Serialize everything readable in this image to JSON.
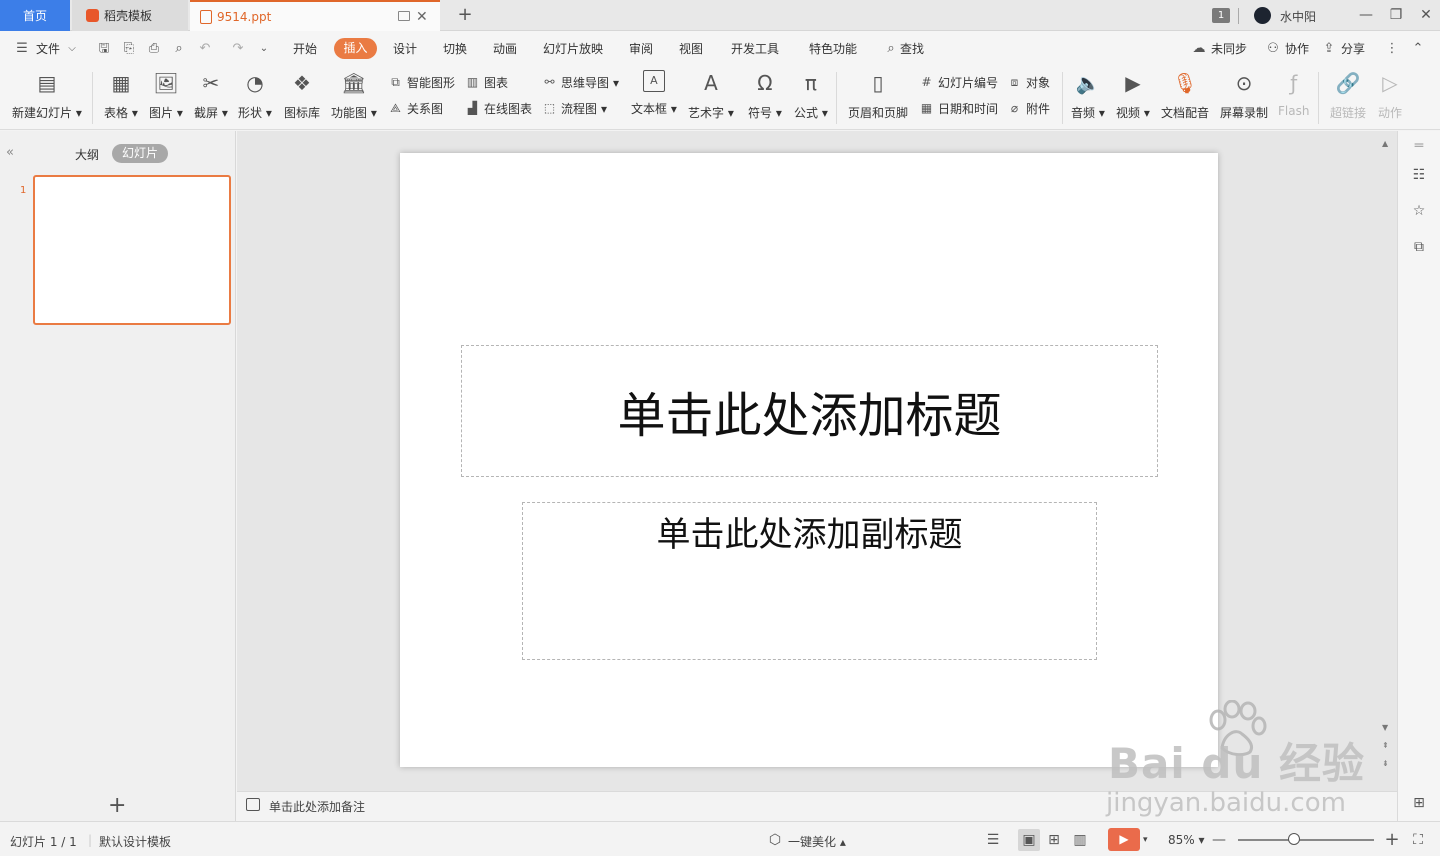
{
  "titlebar": {
    "tab_home": "首页",
    "tab_template": "稻壳模板",
    "tab_file": "9514.ppt",
    "badge": "1",
    "username": "水中阳"
  },
  "menubar": {
    "file": "文件",
    "items": [
      "开始",
      "插入",
      "设计",
      "切换",
      "动画",
      "幻灯片放映",
      "审阅",
      "视图",
      "开发工具",
      "特色功能"
    ],
    "active": "插入",
    "search": "查找",
    "unsynced": "未同步",
    "collab": "协作",
    "share": "分享"
  },
  "ribbon": {
    "new_slide": "新建幻灯片",
    "table": "表格",
    "picture": "图片",
    "screenshot": "截屏",
    "shape": "形状",
    "icon_lib": "图标库",
    "func_chart": "功能图",
    "smart_shape": "智能图形",
    "chart": "图表",
    "relation": "关系图",
    "online_chart": "在线图表",
    "mindmap": "思维导图",
    "flowchart": "流程图",
    "textbox": "文本框",
    "wordart": "艺术字",
    "symbol": "符号",
    "formula": "公式",
    "header_footer": "页眉和页脚",
    "slide_number": "幻灯片编号",
    "object": "对象",
    "date_time": "日期和时间",
    "attachment": "附件",
    "audio": "音频",
    "video": "视频",
    "doc_dub": "文档配音",
    "screen_rec": "屏幕录制",
    "flash": "Flash",
    "hyperlink": "超链接",
    "action": "动作"
  },
  "leftpanel": {
    "outline": "大纲",
    "slides": "幻灯片",
    "slide_number": "1"
  },
  "slide": {
    "title_placeholder": "单击此处添加标题",
    "subtitle_placeholder": "单击此处添加副标题"
  },
  "notes": {
    "placeholder": "单击此处添加备注"
  },
  "statusbar": {
    "slide_counter": "幻灯片 1 / 1",
    "template": "默认设计模板",
    "beautify": "一键美化",
    "zoom": "85%"
  },
  "watermark": {
    "brand": "Bai du 经验",
    "url": "jingyan.baidu.com"
  },
  "colors": {
    "accent": "#ea7b43",
    "home_tab": "#3c7ee8",
    "play": "#ea6b4b"
  }
}
